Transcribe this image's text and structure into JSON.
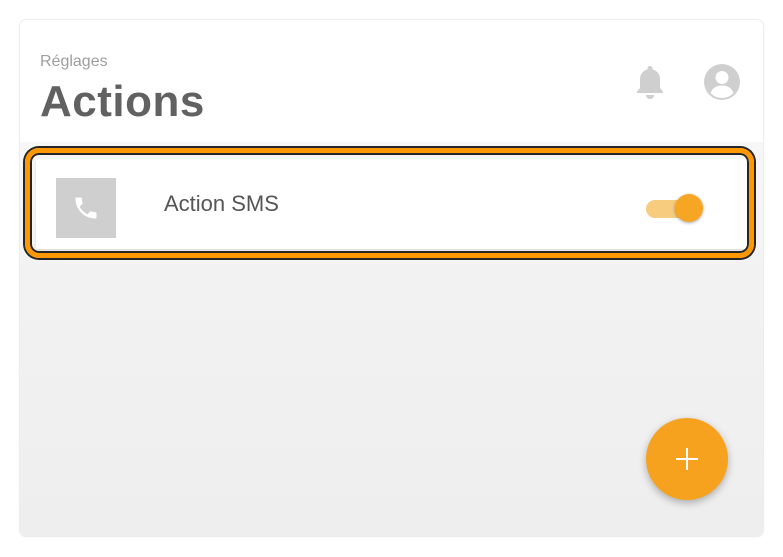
{
  "header": {
    "subtitle": "Réglages",
    "title": "Actions",
    "notification_icon": "bell-icon",
    "account_icon": "account-circle-icon"
  },
  "actions": [
    {
      "label": "Action SMS",
      "icon": "phone-icon",
      "enabled": true
    }
  ],
  "fab": {
    "icon": "plus-icon"
  },
  "colors": {
    "accent": "#f7a21e",
    "highlight_outline": "#ff9800",
    "toggle_track": "#f8cc7e",
    "title_text": "#616161",
    "subtitle_text": "#9e9e9e",
    "icon_tile_bg": "#cfcfcf"
  }
}
